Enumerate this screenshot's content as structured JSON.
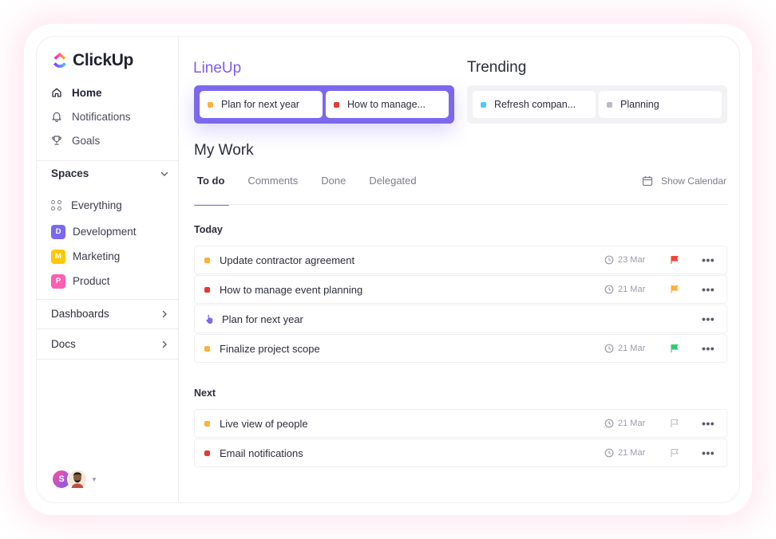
{
  "app": {
    "name": "ClickUp"
  },
  "sidebar": {
    "nav": [
      {
        "label": "Home",
        "icon": "home-icon",
        "active": true
      },
      {
        "label": "Notifications",
        "icon": "bell-icon"
      },
      {
        "label": "Goals",
        "icon": "trophy-icon"
      }
    ],
    "spaces_label": "Spaces",
    "everything_label": "Everything",
    "spaces": [
      {
        "label": "Development",
        "letter": "D",
        "color": "#7b68ee"
      },
      {
        "label": "Marketing",
        "letter": "M",
        "color": "#ffc800"
      },
      {
        "label": "Product",
        "letter": "P",
        "color": "#ff5eb1"
      }
    ],
    "dashboards_label": "Dashboards",
    "docs_label": "Docs",
    "avatar_letter": "S"
  },
  "lineup": {
    "title": "LineUp",
    "items": [
      {
        "label": "Plan for next year",
        "color": "#ffb13b"
      },
      {
        "label": "How to manage...",
        "color": "#e53935"
      }
    ]
  },
  "trending": {
    "title": "Trending",
    "items": [
      {
        "label": "Refresh compan...",
        "color": "#49ccf9"
      },
      {
        "label": "Planning",
        "color": "#b9bcc6"
      }
    ]
  },
  "mywork": {
    "title": "My Work",
    "tabs": [
      "To do",
      "Comments",
      "Done",
      "Delegated"
    ],
    "show_calendar": "Show Calendar",
    "today_label": "Today",
    "today": [
      {
        "name": "Update contractor agreement",
        "color": "#ffb13b",
        "date": "23 Mar",
        "flag": "#f44336"
      },
      {
        "name": "How to manage event planning",
        "color": "#e53935",
        "date": "21 Mar",
        "flag": "#ffb13b"
      },
      {
        "name": "Plan for next year",
        "color": "#7b68ee",
        "date": "",
        "flag": ""
      },
      {
        "name": "Finalize project scope",
        "color": "#ffb13b",
        "date": "21 Mar",
        "flag": "#2ecd6f"
      }
    ],
    "next_label": "Next",
    "next": [
      {
        "name": "Live view of people",
        "color": "#ffb13b",
        "date": "21 Mar",
        "flag": "outline"
      },
      {
        "name": "Email notifications",
        "color": "#e53935",
        "date": "21 Mar",
        "flag": "outline"
      }
    ]
  }
}
